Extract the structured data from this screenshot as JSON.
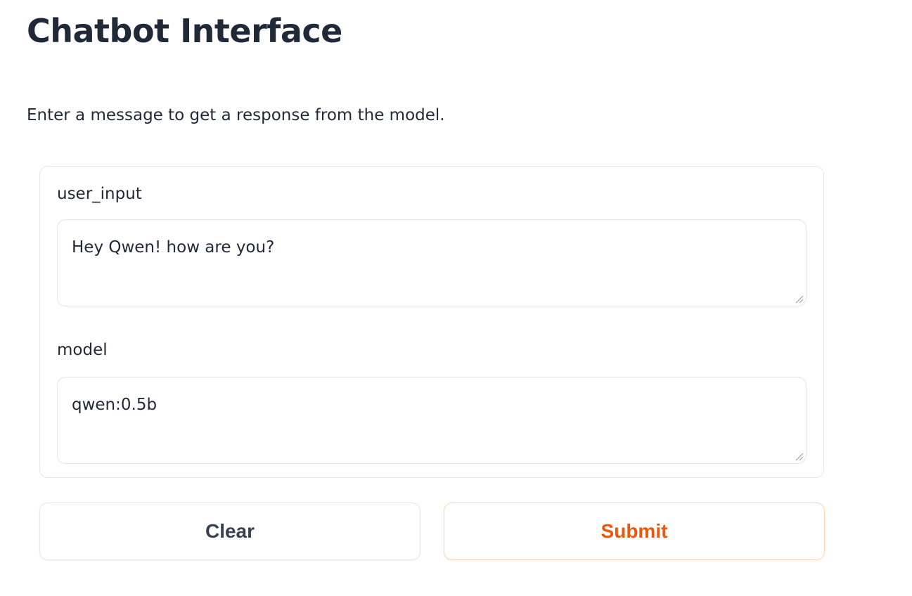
{
  "header": {
    "title": "Chatbot Interface",
    "description": "Enter a message to get a response from the model."
  },
  "form": {
    "fields": [
      {
        "label": "user_input",
        "value": "Hey Qwen! how are you?"
      },
      {
        "label": "model",
        "value": "qwen:0.5b"
      }
    ]
  },
  "actions": {
    "clear_label": "Clear",
    "submit_label": "Submit"
  },
  "colors": {
    "text": "#1f2937",
    "border": "#e5e7eb",
    "submit_text": "#ea580c",
    "submit_border": "#fed7aa"
  }
}
